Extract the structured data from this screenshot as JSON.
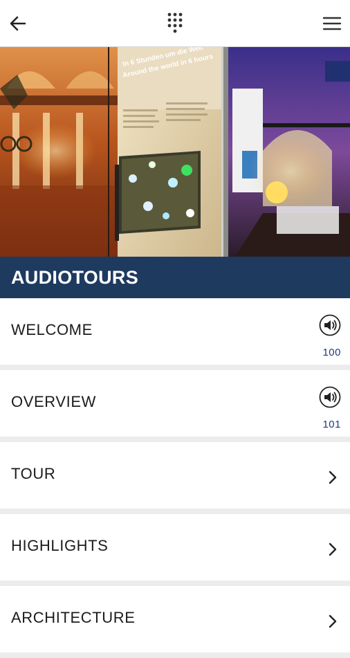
{
  "header": {
    "back_icon": "arrow-left-icon",
    "keypad_icon": "keypad-icon",
    "menu_icon": "hamburger-menu-icon"
  },
  "hero": {
    "description": "Photo collage of museum interiors and exhibits",
    "panel_text_line1": "In 6 Stunden um die Welt",
    "panel_text_line2": "Around the world in 6 hours"
  },
  "section": {
    "title": "AUDIOTOURS"
  },
  "items": [
    {
      "label": "WELCOME",
      "type": "audio",
      "code": "100",
      "icon": "speaker-icon"
    },
    {
      "label": "OVERVIEW",
      "type": "audio",
      "code": "101",
      "icon": "speaker-icon"
    },
    {
      "label": "TOUR",
      "type": "link",
      "icon": "chevron-right-icon"
    },
    {
      "label": "HIGHLIGHTS",
      "type": "link",
      "icon": "chevron-right-icon"
    },
    {
      "label": "ARCHITECTURE",
      "type": "link",
      "icon": "chevron-right-icon"
    }
  ],
  "colors": {
    "header_band": "#1e3a5f",
    "code_text": "#1e3a7a",
    "background": "#ececec"
  }
}
